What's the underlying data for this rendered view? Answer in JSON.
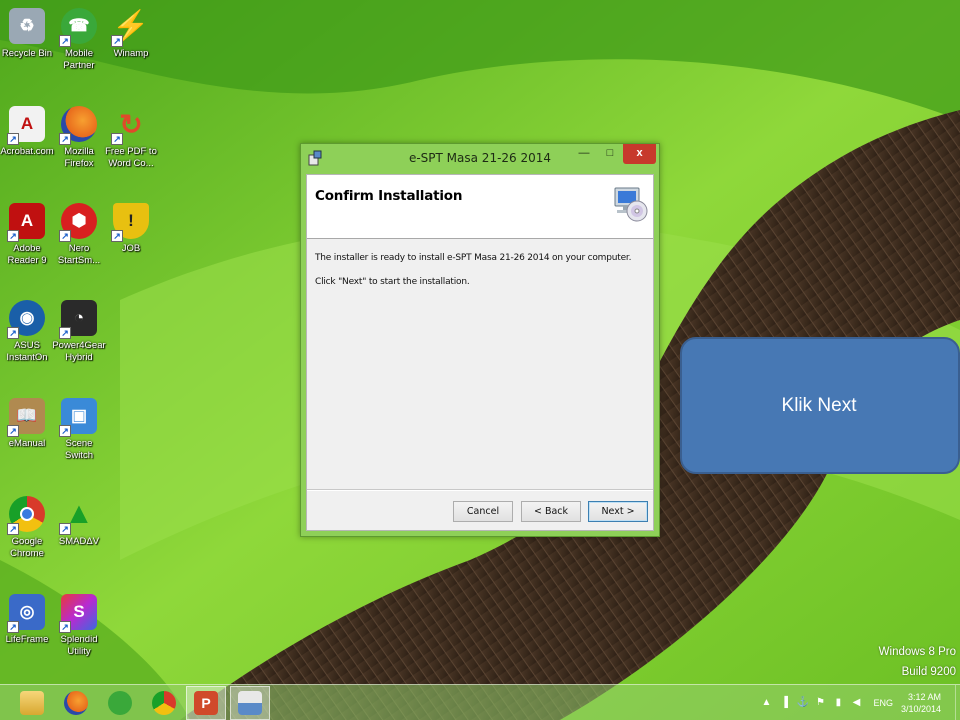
{
  "desktop": {
    "icons": [
      {
        "label": "Recycle Bin",
        "icon": "recycle-bin-icon",
        "color": "#9aa8b4"
      },
      {
        "label": "Mobile Partner",
        "icon": "mobile-partner-icon",
        "color": "#3aa83a"
      },
      {
        "label": "Winamp",
        "icon": "winamp-icon",
        "color": "#e8b018"
      },
      {
        "label": "Acrobat.com",
        "icon": "acrobat-icon",
        "color": "#f2f2f2"
      },
      {
        "label": "Mozilla Firefox",
        "icon": "firefox-icon",
        "color": "#e86a1c"
      },
      {
        "label": "Free PDF to Word Co...",
        "icon": "pdf-to-word-icon",
        "color": "#e04a2a"
      },
      {
        "label": "Adobe Reader 9",
        "icon": "adobe-reader-icon",
        "color": "#c01010"
      },
      {
        "label": "Nero StartSm...",
        "icon": "nero-icon",
        "color": "#d82020"
      },
      {
        "label": "JOB",
        "icon": "shield-icon",
        "color": "#e8c010"
      },
      {
        "label": "ASUS InstantOn",
        "icon": "asus-instanton-icon",
        "color": "#1a5fa8"
      },
      {
        "label": "Power4Gear Hybrid",
        "icon": "power4gear-icon",
        "color": "#2a2a2a"
      },
      {
        "label": "eManual",
        "icon": "emanual-icon",
        "color": "#b08a50"
      },
      {
        "label": "Scene Switch",
        "icon": "scene-switch-icon",
        "color": "#3a8ad8"
      },
      {
        "label": "Google Chrome",
        "icon": "chrome-icon",
        "color": "#d83a2a"
      },
      {
        "label": "SMADΔV",
        "icon": "smadav-icon",
        "color": "#18a028"
      },
      {
        "label": "LifeFrame",
        "icon": "lifeframe-icon",
        "color": "#3a6ac8"
      },
      {
        "label": "Splendid Utility",
        "icon": "splendid-icon",
        "color": "#b82ad0"
      }
    ]
  },
  "window": {
    "title": "e-SPT Masa 21-26 2014",
    "min_label": "—",
    "max_label": "□",
    "close_label": "x",
    "heading": "Confirm Installation",
    "line1": "The installer is ready to install e-SPT Masa 21-26 2014 on your computer.",
    "line2": "Click \"Next\" to start the installation.",
    "buttons": {
      "cancel": "Cancel",
      "back": "< Back",
      "next": "Next >"
    }
  },
  "callout": {
    "text": "Klik Next"
  },
  "watermark": {
    "line1": "Windows 8 Pro",
    "line2": "Build 9200"
  },
  "taskbar": {
    "apps": [
      {
        "icon": "file-explorer-icon",
        "color": "#e8c060"
      },
      {
        "icon": "firefox-icon",
        "color": "#e86a1c"
      },
      {
        "icon": "mobile-partner-icon",
        "color": "#3aa83a"
      },
      {
        "icon": "chrome-icon",
        "color": "#d83a2a"
      },
      {
        "icon": "powerpoint-icon",
        "color": "#d04a2a"
      },
      {
        "icon": "installer-icon",
        "color": "#5a8ac8"
      }
    ],
    "tray": {
      "lang": "ENG",
      "time": "3:12 AM",
      "date": "3/10/2014"
    }
  },
  "colors": {
    "window_frame": "#8ed058",
    "close_button": "#c7392c",
    "callout_fill": "#4778b4"
  }
}
